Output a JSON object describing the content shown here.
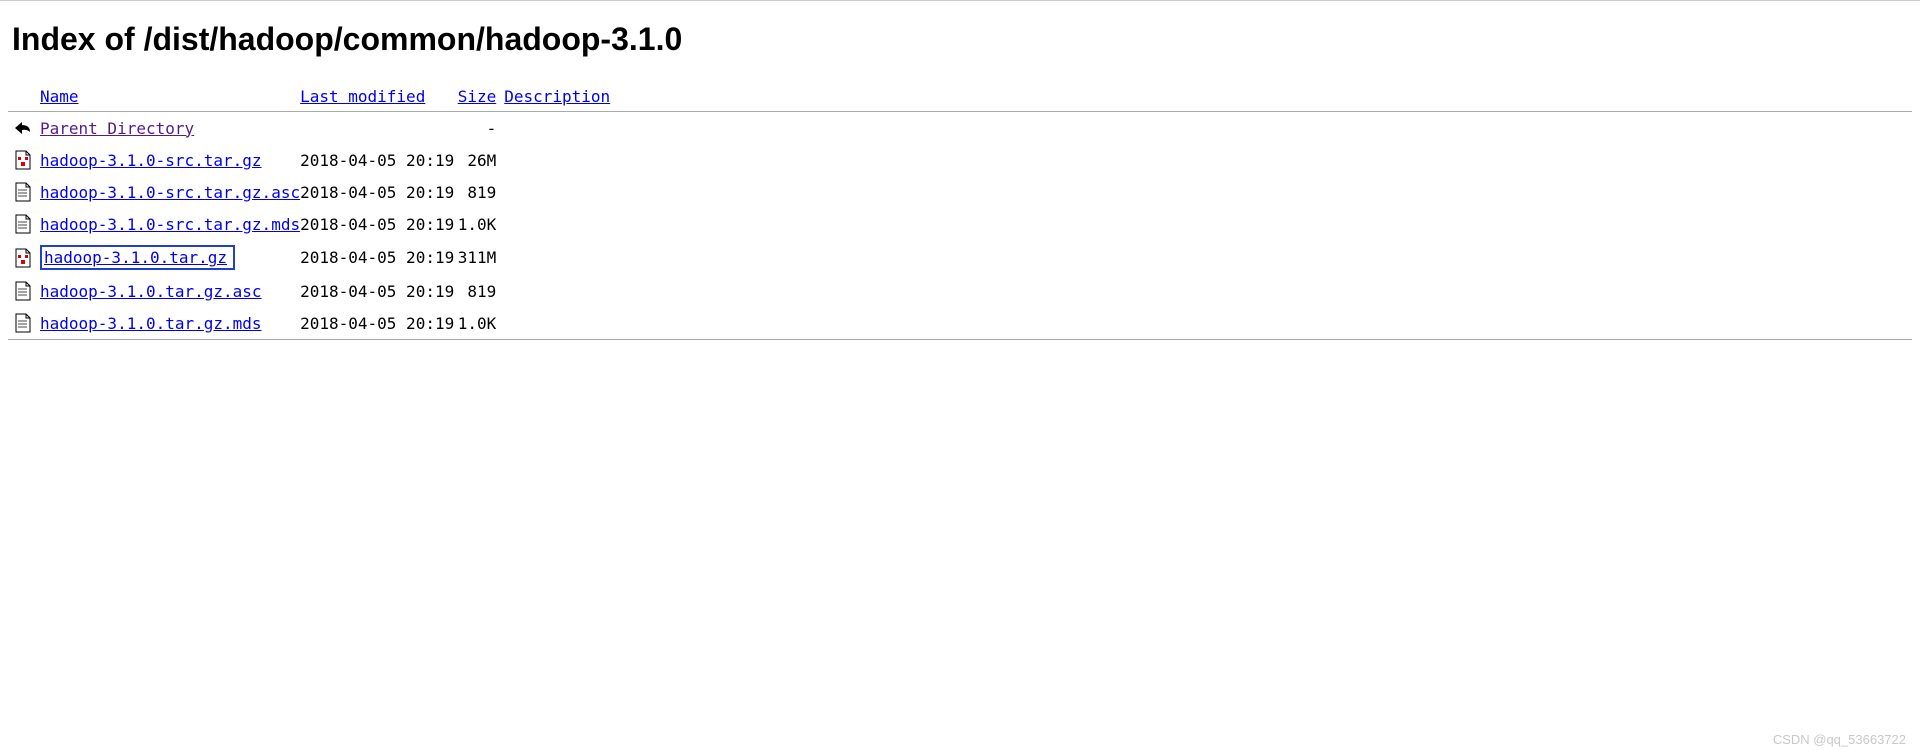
{
  "title": "Index of /dist/hadoop/common/hadoop-3.1.0",
  "headers": {
    "name": "Name",
    "last_modified": "Last modified",
    "size": "Size",
    "description": "Description"
  },
  "parent": {
    "label": "Parent Directory",
    "size": "-"
  },
  "files": [
    {
      "icon": "archive",
      "name": "hadoop-3.1.0-src.tar.gz",
      "modified": "2018-04-05 20:19",
      "size": "26M",
      "highlighted": false
    },
    {
      "icon": "text",
      "name": "hadoop-3.1.0-src.tar.gz.asc",
      "modified": "2018-04-05 20:19",
      "size": "819",
      "highlighted": false
    },
    {
      "icon": "text",
      "name": "hadoop-3.1.0-src.tar.gz.mds",
      "modified": "2018-04-05 20:19",
      "size": "1.0K",
      "highlighted": false
    },
    {
      "icon": "archive",
      "name": "hadoop-3.1.0.tar.gz",
      "modified": "2018-04-05 20:19",
      "size": "311M",
      "highlighted": true
    },
    {
      "icon": "text",
      "name": "hadoop-3.1.0.tar.gz.asc",
      "modified": "2018-04-05 20:19",
      "size": "819",
      "highlighted": false
    },
    {
      "icon": "text",
      "name": "hadoop-3.1.0.tar.gz.mds",
      "modified": "2018-04-05 20:19",
      "size": "1.0K",
      "highlighted": false
    }
  ],
  "watermark": "CSDN @qq_53663722"
}
